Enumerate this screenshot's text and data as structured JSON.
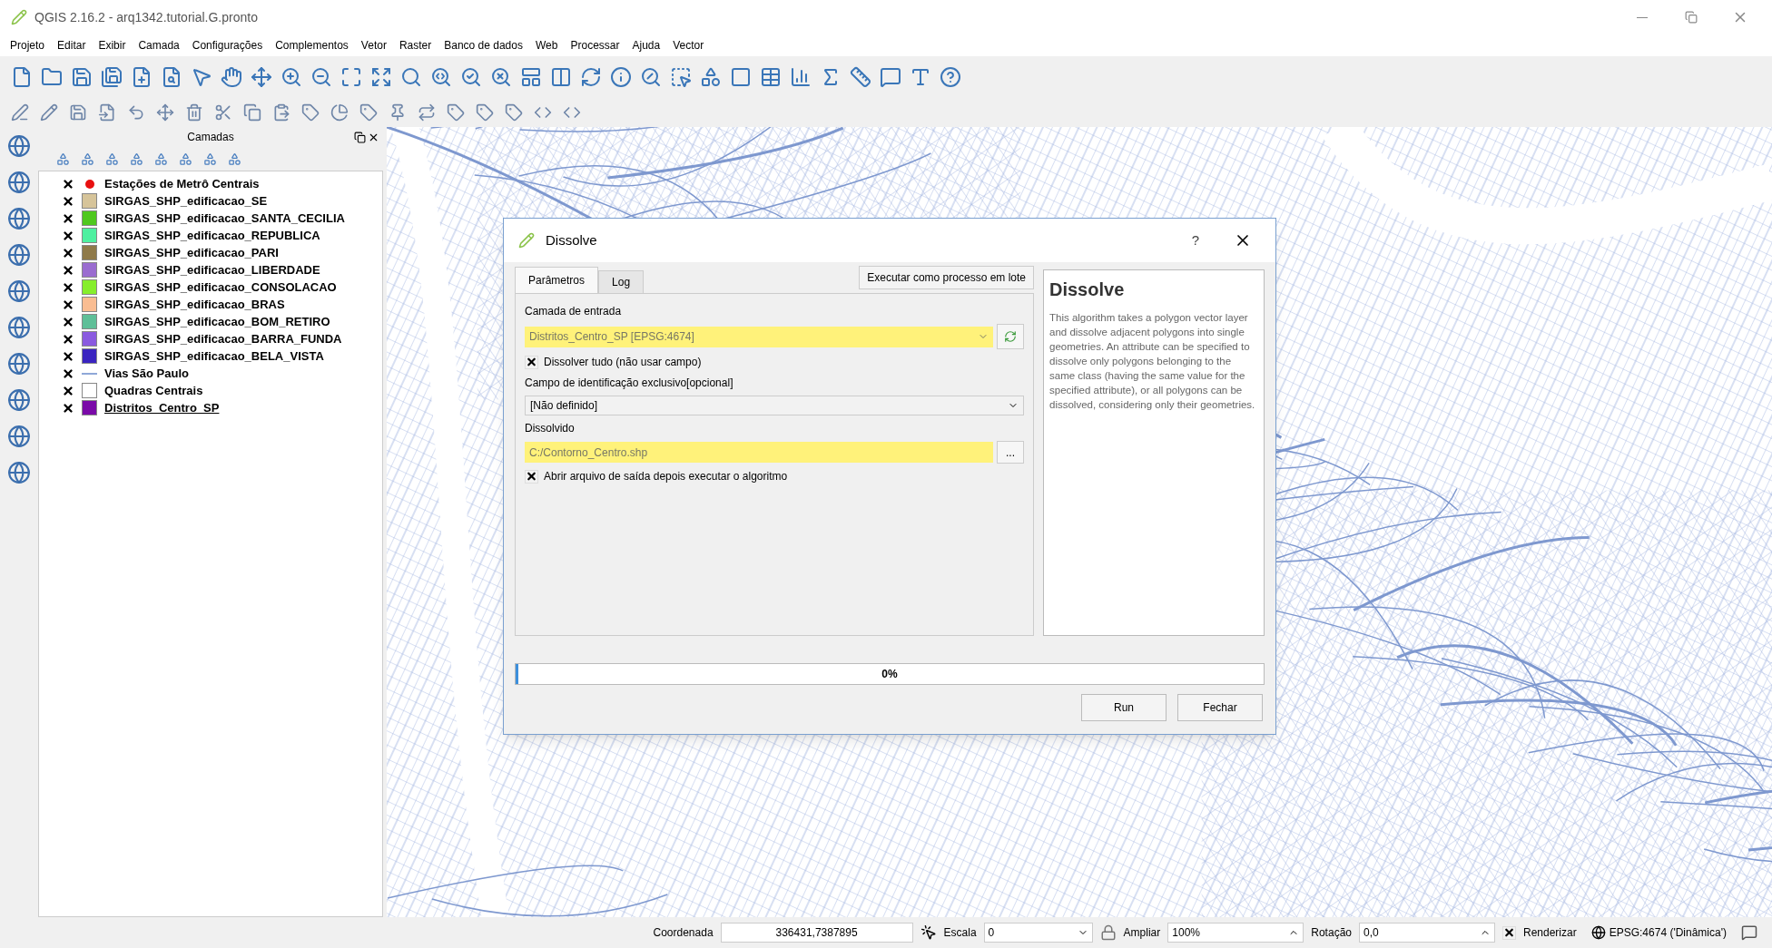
{
  "window": {
    "title": "QGIS 2.16.2 - arq1342.tutorial.G.pronto"
  },
  "menu": [
    "Projeto",
    "Editar",
    "Exibir",
    "Camada",
    "Configurações",
    "Complementos",
    "Vetor",
    "Raster",
    "Banco de dados",
    "Web",
    "Processar",
    "Ajuda",
    "Vector"
  ],
  "layers_panel": {
    "title": "Camadas",
    "layers": [
      {
        "name": "Estações de Metrô Centrais",
        "checked": true,
        "kind": "point",
        "color": "#e81010",
        "selected": false
      },
      {
        "name": "SIRGAS_SHP_edificacao_SE",
        "checked": true,
        "kind": "polygon",
        "color": "#d6c49a",
        "selected": false
      },
      {
        "name": "SIRGAS_SHP_edificacao_SANTA_CECILIA",
        "checked": true,
        "kind": "polygon",
        "color": "#4fc81e",
        "selected": false
      },
      {
        "name": "SIRGAS_SHP_edificacao_REPUBLICA",
        "checked": true,
        "kind": "polygon",
        "color": "#4ef0a0",
        "selected": false
      },
      {
        "name": "SIRGAS_SHP_edificacao_PARI",
        "checked": true,
        "kind": "polygon",
        "color": "#8f7a4a",
        "selected": false
      },
      {
        "name": "SIRGAS_SHP_edificacao_LIBERDADE",
        "checked": true,
        "kind": "polygon",
        "color": "#9a6cd0",
        "selected": false
      },
      {
        "name": "SIRGAS_SHP_edificacao_CONSOLACAO",
        "checked": true,
        "kind": "polygon",
        "color": "#86ee2c",
        "selected": false
      },
      {
        "name": "SIRGAS_SHP_edificacao_BRAS",
        "checked": true,
        "kind": "polygon",
        "color": "#f9bd92",
        "selected": false
      },
      {
        "name": "SIRGAS_SHP_edificacao_BOM_RETIRO",
        "checked": true,
        "kind": "polygon",
        "color": "#5fbf98",
        "selected": false
      },
      {
        "name": "SIRGAS_SHP_edificacao_BARRA_FUNDA",
        "checked": true,
        "kind": "polygon",
        "color": "#8a5ae0",
        "selected": false
      },
      {
        "name": "SIRGAS_SHP_edificacao_BELA_VISTA",
        "checked": true,
        "kind": "polygon",
        "color": "#3a24c0",
        "selected": false
      },
      {
        "name": "Vias São Paulo",
        "checked": true,
        "kind": "line",
        "color": "#8fa8d8",
        "selected": false
      },
      {
        "name": "Quadras Centrais",
        "checked": true,
        "kind": "polygon",
        "color": "#ffffff",
        "selected": false
      },
      {
        "name": "Distritos_Centro_SP",
        "checked": true,
        "kind": "polygon",
        "color": "#7a0aa8",
        "selected": true
      }
    ]
  },
  "dialog": {
    "title": "Dissolve",
    "help": "?",
    "tabs": [
      {
        "label": "Parâmetros",
        "selected": true
      },
      {
        "label": "Log",
        "selected": false
      }
    ],
    "batch_button": "Executar como processo em lote",
    "input_label": "Camada de entrada",
    "input_value": "Distritos_Centro_SP [EPSG:4674]",
    "dissolve_all": {
      "label": "Dissolver tudo (não usar campo)",
      "checked": true
    },
    "field_label": "Campo de identificação exclusivo[opcional]",
    "field_value": "[Não definido]",
    "output_label": "Dissolvido",
    "output_value": "C:/Contorno_Centro.shp",
    "browse": "...",
    "open_output": {
      "label": "Abrir arquivo de saída depois executar o algoritmo",
      "checked": true
    },
    "help_title": "Dissolve",
    "help_text": "This algorithm takes a polygon vector layer and dissolve adjacent polygons into single geometries. An attribute can be specified to dissolve only polygons belonging to the same class (having the same value for the specified attribute), or all polygons can be dissolved, considering only their geometries.",
    "progress": {
      "level": 0,
      "reading": "0%"
    },
    "buttons": [
      "Run",
      "Fechar"
    ]
  },
  "status_bar": {
    "coord_label": "Coordenada",
    "coord_value": "336431,7387895",
    "scale_label": "Escala",
    "scale_value": "0",
    "magnify_label": "Ampliar",
    "magnify_value": "100%",
    "rotation_label": "Rotação",
    "rotation_value": "0,0",
    "render": {
      "label": "Renderizar",
      "checked": true
    },
    "crs": "EPSG:4674 ('Dinâmica')"
  }
}
